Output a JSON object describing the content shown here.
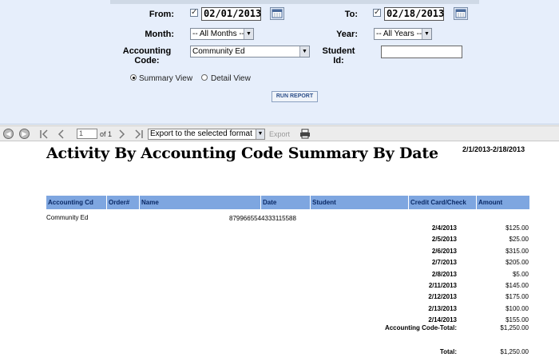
{
  "filters": {
    "from_label": "From:",
    "from_date": "02/01/2013",
    "to_label": "To:",
    "to_date": "02/18/2013",
    "month_label": "Month:",
    "month_value": "-- All Months --",
    "year_label": "Year:",
    "year_value": "-- All Years --",
    "accounting_code_label_1": "Accounting",
    "accounting_code_label_2": "Code:",
    "accounting_code_value": "Community Ed",
    "student_id_label_1": "Student",
    "student_id_label_2": "Id:",
    "student_id_value": "",
    "summary_view_label": "Summary View",
    "detail_view_label": "Detail View",
    "run_report_label": "RUN REPORT",
    "checkmark_glyph": "✓"
  },
  "toolbar": {
    "page_number": "1",
    "of_pages": "of 1",
    "export_select": "Export to the selected format",
    "export_label": "Export"
  },
  "report": {
    "title": "Activity By Accounting Code Summary By Date",
    "date_range": "2/1/2013-2/18/2013",
    "columns": [
      "Accounting Cd",
      "Order#",
      "Name",
      "Date",
      "Student",
      "Credit Card/Check",
      "Amount"
    ],
    "group_name": "Community Ed",
    "card_number": "8799665544333115588",
    "rows": [
      {
        "date": "2/4/2013",
        "amount": "$125.00"
      },
      {
        "date": "2/5/2013",
        "amount": "$25.00"
      },
      {
        "date": "2/6/2013",
        "amount": "$315.00"
      },
      {
        "date": "2/7/2013",
        "amount": "$205.00"
      },
      {
        "date": "2/8/2013",
        "amount": "$5.00"
      },
      {
        "date": "2/11/2013",
        "amount": "$145.00"
      },
      {
        "date": "2/12/2013",
        "amount": "$175.00"
      },
      {
        "date": "2/13/2013",
        "amount": "$100.00"
      },
      {
        "date": "2/14/2013",
        "amount": "$155.00"
      }
    ],
    "subtotal_label": "Accounting Code-Total:",
    "subtotal_value": "$1,250.00",
    "total_label": "Total:",
    "total_value": "$1,250.00"
  },
  "colors": {
    "panel_bg": "#e6eefb",
    "header_bg": "#7ea6e0",
    "header_text": "#0b2a66"
  },
  "icons": {
    "calendar": "calendar-icon",
    "first_page": "first-page-icon",
    "prev_page": "prev-page-icon",
    "next_page": "next-page-icon",
    "last_page": "last-page-icon",
    "back": "back-icon",
    "forward": "forward-icon",
    "print": "print-icon",
    "dropdown": "chevron-down-icon"
  }
}
